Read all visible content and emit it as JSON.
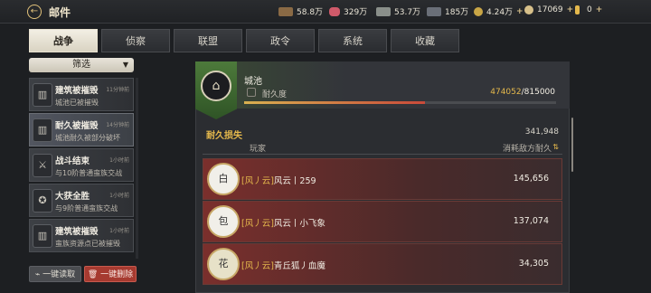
{
  "header": {
    "back_icon": "back-arrow-icon",
    "title": "邮件",
    "resources": [
      {
        "icon": "wood-icon",
        "value": "58.8万",
        "color": "#8a6a45"
      },
      {
        "icon": "food-icon",
        "value": "329万",
        "color": "#d05a6a"
      },
      {
        "icon": "stone-icon",
        "value": "53.7万",
        "color": "#8a8f8a"
      },
      {
        "icon": "iron-icon",
        "value": "185万",
        "color": "#6a6f78"
      },
      {
        "icon": "gold-ore-icon",
        "value": "4.24万",
        "color": "#c9a646",
        "plus": "+"
      },
      {
        "icon": "coin-icon",
        "value": "17069",
        "color": "#d7c08a",
        "plus": "+"
      },
      {
        "icon": "gem-icon",
        "value": "0",
        "color": "#e4b84c",
        "plus": "+"
      }
    ]
  },
  "tabs": [
    {
      "label": "战争",
      "active": true
    },
    {
      "label": "侦察",
      "active": false
    },
    {
      "label": "联盟",
      "active": false
    },
    {
      "label": "政令",
      "active": false
    },
    {
      "label": "系统",
      "active": false
    },
    {
      "label": "收藏",
      "active": false
    }
  ],
  "filter": {
    "label": "筛选"
  },
  "mails": [
    {
      "title": "建筑被摧毁",
      "time": "11分钟前",
      "desc": "城池已被摧毁",
      "icon": "building-icon",
      "active": false
    },
    {
      "title": "耐久被摧毁",
      "time": "14分钟前",
      "desc": "城池耐久被部分破坏",
      "icon": "building-icon",
      "active": true
    },
    {
      "title": "战斗结束",
      "time": "1小时前",
      "desc": "与10阶普通蛮族交战",
      "icon": "battle-icon",
      "active": false
    },
    {
      "title": "大获全胜",
      "time": "1小时前",
      "desc": "与9阶普通蛮族交战",
      "icon": "victory-icon",
      "active": false
    },
    {
      "title": "建筑被摧毁",
      "time": "1小时前",
      "desc": "蛮族资源点已被摧毁",
      "icon": "building-icon",
      "active": false
    }
  ],
  "actions": {
    "read_all": "一键读取",
    "delete_all": "一键删除"
  },
  "city": {
    "name": "城池",
    "durability_label": "耐久度",
    "durability_current": "474052",
    "durability_max": "/815000",
    "durability_fraction": 0.58
  },
  "loss": {
    "title": "耐久损失",
    "total": "341,948",
    "col_player": "玩家",
    "col_damage": "消耗敌方耐久"
  },
  "players": [
    {
      "tag": "[风丿云]",
      "name": "风云丨259",
      "damage": "145,656",
      "avatar": "白"
    },
    {
      "tag": "[风丿云]",
      "name": "风云丨小飞象",
      "damage": "137,074",
      "avatar": "包"
    },
    {
      "tag": "[风丿云]",
      "name": "青丘狐丿血魔",
      "damage": "34,305",
      "avatar": "花"
    }
  ]
}
